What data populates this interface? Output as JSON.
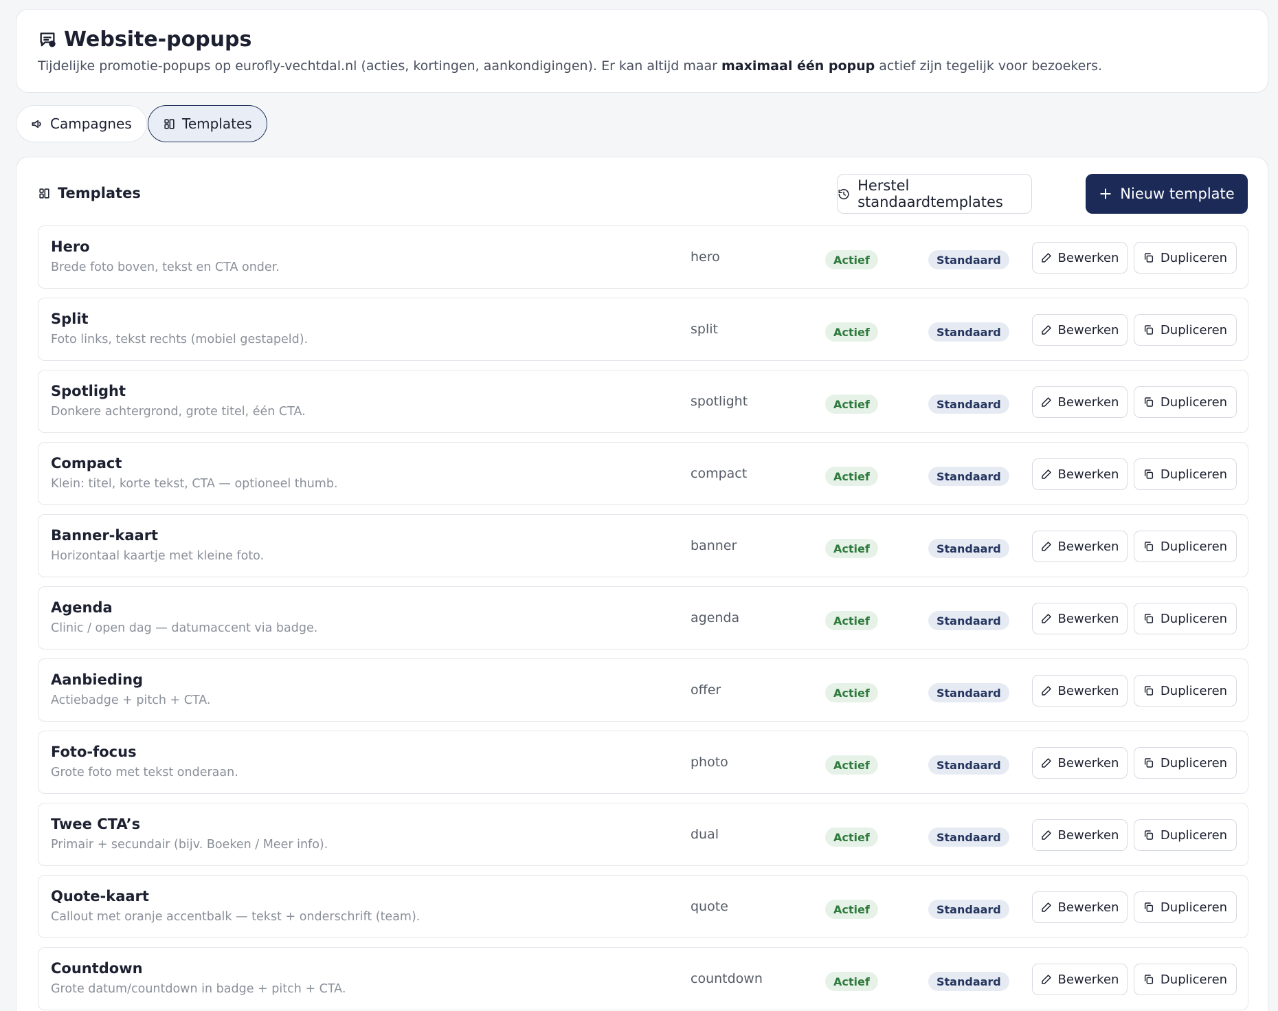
{
  "header": {
    "title": "Website-popups",
    "desc_prefix": "Tijdelijke promotie-popups op eurofly-vechtdal.nl (acties, kortingen, aankondigingen). Er kan altijd maar ",
    "desc_bold": "maximaal één popup",
    "desc_suffix": " actief zijn tegelijk voor bezoekers."
  },
  "tabs": [
    {
      "label": "Campagnes",
      "icon": "megaphone-icon",
      "active": false
    },
    {
      "label": "Templates",
      "icon": "layout-icon",
      "active": true
    }
  ],
  "section": {
    "title": "Templates",
    "restore_label": "Herstel standaardtemplates",
    "new_label": "Nieuw template"
  },
  "row_labels": {
    "status": "Actief",
    "standard": "Standaard",
    "edit": "Bewerken",
    "duplicate": "Dupliceren"
  },
  "templates": [
    {
      "name": "Hero",
      "desc": "Brede foto boven, tekst en CTA onder.",
      "key": "hero"
    },
    {
      "name": "Split",
      "desc": "Foto links, tekst rechts (mobiel gestapeld).",
      "key": "split"
    },
    {
      "name": "Spotlight",
      "desc": "Donkere achtergrond, grote titel, één CTA.",
      "key": "spotlight"
    },
    {
      "name": "Compact",
      "desc": "Klein: titel, korte tekst, CTA — optioneel thumb.",
      "key": "compact"
    },
    {
      "name": "Banner-kaart",
      "desc": "Horizontaal kaartje met kleine foto.",
      "key": "banner"
    },
    {
      "name": "Agenda",
      "desc": "Clinic / open dag — datumaccent via badge.",
      "key": "agenda"
    },
    {
      "name": "Aanbieding",
      "desc": "Actiebadge + pitch + CTA.",
      "key": "offer"
    },
    {
      "name": "Foto-focus",
      "desc": "Grote foto met tekst onderaan.",
      "key": "photo"
    },
    {
      "name": "Twee CTA’s",
      "desc": "Primair + secundair (bijv. Boeken / Meer info).",
      "key": "dual"
    },
    {
      "name": "Quote-kaart",
      "desc": "Callout met oranje accentbalk — tekst + onderschrift (team).",
      "key": "quote"
    },
    {
      "name": "Countdown",
      "desc": "Grote datum/countdown in badge + pitch + CTA.",
      "key": "countdown"
    }
  ],
  "colors": {
    "primary": "#1b2a57",
    "active_badge_bg": "#e6f2e8",
    "active_badge_text": "#2f7a3d",
    "standard_badge_bg": "#e6ebf3"
  }
}
